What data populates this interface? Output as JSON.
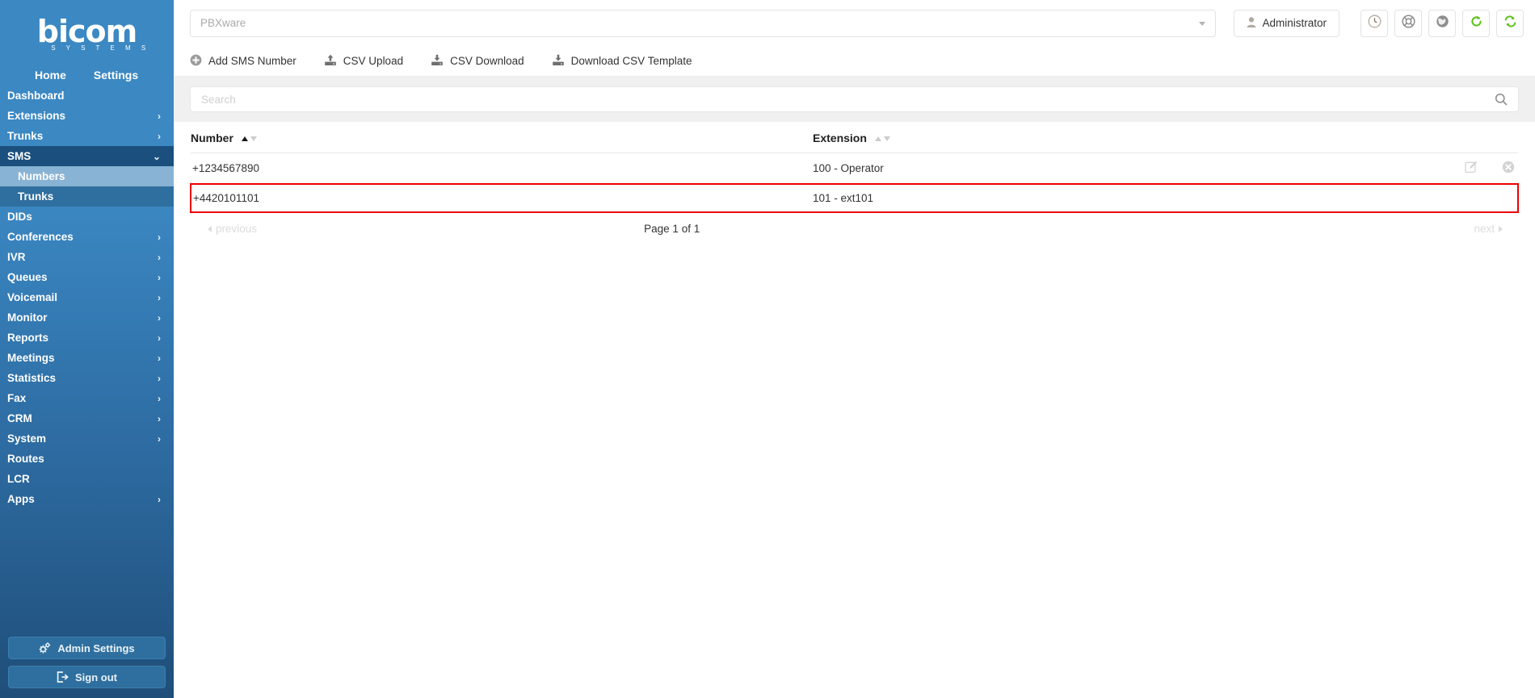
{
  "brand": {
    "name": "bicom",
    "tagline": "S Y S T E M S"
  },
  "tabs": [
    {
      "label": "Home",
      "active": true
    },
    {
      "label": "Settings",
      "active": false
    }
  ],
  "sidebar": {
    "items": [
      {
        "label": "Dashboard",
        "chevron": ""
      },
      {
        "label": "Extensions",
        "chevron": "›"
      },
      {
        "label": "Trunks",
        "chevron": "›"
      },
      {
        "label": "SMS",
        "chevron": "⌄",
        "expanded": true
      },
      {
        "label": "DIDs",
        "chevron": ""
      },
      {
        "label": "Conferences",
        "chevron": "›"
      },
      {
        "label": "IVR",
        "chevron": "›"
      },
      {
        "label": "Queues",
        "chevron": "›"
      },
      {
        "label": "Voicemail",
        "chevron": "›"
      },
      {
        "label": "Monitor",
        "chevron": "›"
      },
      {
        "label": "Reports",
        "chevron": "›"
      },
      {
        "label": "Meetings",
        "chevron": "›"
      },
      {
        "label": "Statistics",
        "chevron": "›"
      },
      {
        "label": "Fax",
        "chevron": "›"
      },
      {
        "label": "CRM",
        "chevron": "›"
      },
      {
        "label": "System",
        "chevron": "›"
      },
      {
        "label": "Routes",
        "chevron": ""
      },
      {
        "label": "LCR",
        "chevron": ""
      },
      {
        "label": "Apps",
        "chevron": "›"
      }
    ],
    "sms_subitems": [
      {
        "label": "Numbers",
        "active": true
      },
      {
        "label": "Trunks",
        "active": false
      }
    ],
    "admin_settings_label": "Admin Settings",
    "sign_out_label": "Sign out"
  },
  "topbar": {
    "server_select_placeholder": "PBXware",
    "admin_label": "Administrator",
    "icons": [
      "clock-icon",
      "lifebuoy-icon",
      "globe-icon",
      "reload-icon",
      "sync-icon"
    ]
  },
  "toolbar": {
    "buttons": [
      {
        "label": "Add SMS Number",
        "icon": "plus-circle-icon"
      },
      {
        "label": "CSV Upload",
        "icon": "upload-icon"
      },
      {
        "label": "CSV Download",
        "icon": "download-icon"
      },
      {
        "label": "Download CSV Template",
        "icon": "download-icon"
      }
    ]
  },
  "search": {
    "placeholder": "Search",
    "value": "",
    "icon": "search-icon"
  },
  "table": {
    "columns": [
      {
        "label": "Number",
        "sort_asc_active": true,
        "sort_desc_active": false
      },
      {
        "label": "Extension",
        "sort_asc_active": false,
        "sort_desc_active": false
      }
    ],
    "rows": [
      {
        "number": "+1234567890",
        "extension": "100 - Operator",
        "highlighted": false,
        "has_actions": true
      },
      {
        "number": "+4420101101",
        "extension": "101 - ext101",
        "highlighted": true,
        "has_actions": false
      }
    ],
    "row_actions": [
      {
        "icon": "edit-icon"
      },
      {
        "icon": "delete-icon"
      }
    ]
  },
  "pagination": {
    "previous_label": "previous",
    "page_label": "Page 1 of 1",
    "next_label": "next"
  },
  "colors": {
    "sidebar_top": "#3b88c3",
    "sidebar_bottom": "#1f4e79",
    "active_subitem": "#89b3d4",
    "highlight_border": "#ee0000",
    "refresh_green": "#5cc419",
    "search_band": "#f0f0f0"
  }
}
